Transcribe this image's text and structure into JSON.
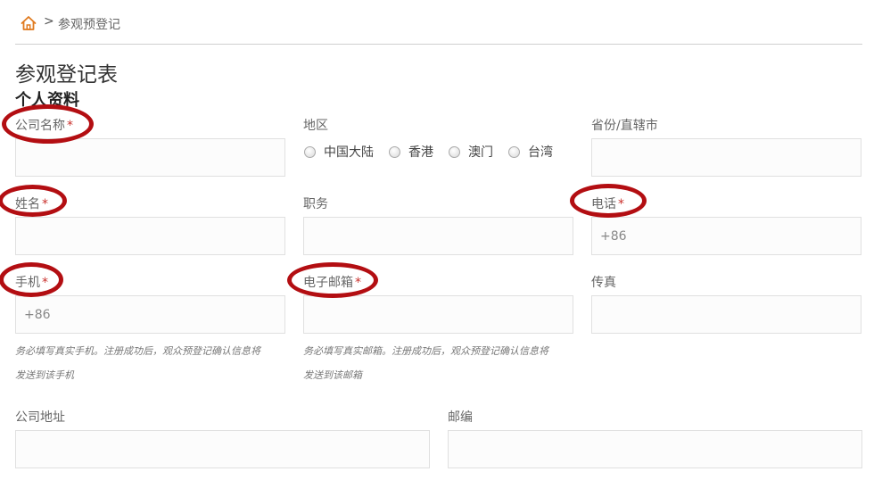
{
  "breadcrumb": {
    "separator": ">",
    "current": "参观预登记"
  },
  "page_title": "参观登记表",
  "section_title": "个人资料",
  "fields": {
    "company_name": {
      "label": "公司名称",
      "required_mark": "*"
    },
    "region": {
      "label": "地区",
      "options": [
        "中国大陆",
        "香港",
        "澳门",
        "台湾"
      ]
    },
    "province": {
      "label": "省份/直辖市"
    },
    "name": {
      "label": "姓名",
      "required_mark": "*"
    },
    "job_title": {
      "label": "职务"
    },
    "phone": {
      "label": "电话",
      "required_mark": "*",
      "placeholder": "+86"
    },
    "mobile": {
      "label": "手机",
      "required_mark": "*",
      "placeholder": "+86",
      "hint_line1": "务必填写真实手机。注册成功后，观众预登记确认信息将",
      "hint_line2": "发送到该手机"
    },
    "email": {
      "label": "电子邮箱",
      "required_mark": "*",
      "hint_line1": "务必填写真实邮箱。注册成功后，观众预登记确认信息将",
      "hint_line2": "发送到该邮箱"
    },
    "fax": {
      "label": "传真"
    },
    "company_address": {
      "label": "公司地址"
    },
    "postcode": {
      "label": "邮编"
    }
  },
  "colors": {
    "home_icon": "#e07a1f",
    "required": "#c9302c",
    "annotation_ring": "#b30e12"
  },
  "icons": {
    "home": "home-icon"
  }
}
